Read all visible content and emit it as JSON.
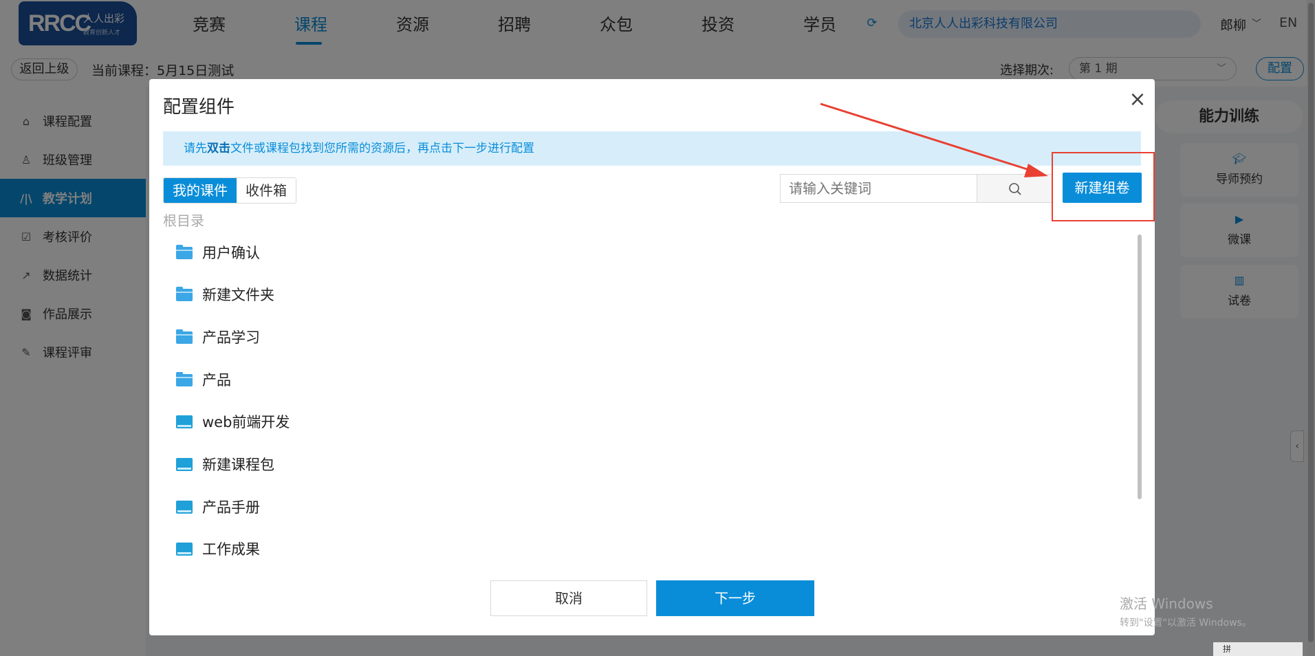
{
  "logo": {
    "mark": "RRCC",
    "name": "人人出彩",
    "slogan": "教育创新人才"
  },
  "nav": {
    "items": [
      "竞赛",
      "课程",
      "资源",
      "招聘",
      "众包",
      "投资",
      "学员"
    ],
    "active_index": 1
  },
  "header": {
    "company": "北京人人出彩科技有限公司",
    "user": "郎柳",
    "lang": "EN"
  },
  "subbar": {
    "back": "返回上级",
    "course": "当前课程：5月15日测试",
    "period_label": "选择期次:",
    "period_value": "第 1 期",
    "config": "配置"
  },
  "sidebar": {
    "items": [
      {
        "label": "课程配置",
        "icon": "home-icon"
      },
      {
        "label": "班级管理",
        "icon": "user-settings-icon"
      },
      {
        "label": "教学计划",
        "icon": "plan-icon"
      },
      {
        "label": "考核评价",
        "icon": "calendar-check-icon"
      },
      {
        "label": "数据统计",
        "icon": "chart-line-icon"
      },
      {
        "label": "作品展示",
        "icon": "camera-icon"
      },
      {
        "label": "课程评审",
        "icon": "review-icon"
      }
    ],
    "active_index": 2
  },
  "right_panel": {
    "title": "能力训练",
    "tools": [
      "导师预约",
      "微课",
      "试卷"
    ]
  },
  "modal": {
    "title": "配置组件",
    "notice_pre": "请先",
    "notice_bold": "双击",
    "notice_post": "文件或课程包找到您所需的资源后，再点击下一步进行配置",
    "tabs": [
      "我的课件",
      "收件箱"
    ],
    "active_tab": 0,
    "search_placeholder": "请输入关键词",
    "new_exam": "新建组卷",
    "breadcrumb": "根目录",
    "files": [
      {
        "name": "用户确认",
        "type": "folder"
      },
      {
        "name": "新建文件夹",
        "type": "folder"
      },
      {
        "name": "产品学习",
        "type": "folder"
      },
      {
        "name": "产品",
        "type": "folder"
      },
      {
        "name": "web前端开发",
        "type": "package"
      },
      {
        "name": "新建课程包",
        "type": "package"
      },
      {
        "name": "产品手册",
        "type": "package"
      },
      {
        "name": "工作成果",
        "type": "package"
      }
    ],
    "cancel": "取消",
    "next": "下一步"
  },
  "watermark": {
    "line1": "激活 Windows",
    "line2": "转到\"设置\"以激活 Windows。"
  },
  "ime": "拼",
  "colors": {
    "primary": "#0a8dd9",
    "annotation": "#e84033",
    "notice_bg": "#d7eefa"
  }
}
